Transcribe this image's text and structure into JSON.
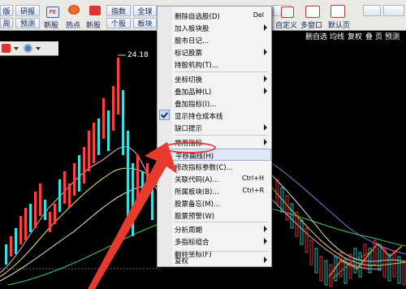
{
  "toolbar": {
    "row1": {
      "b1": "版",
      "b2": "研报",
      "b3": "指数",
      "b4": "全球"
    },
    "row2": {
      "b1": "周",
      "b2": "预测",
      "b3": "新股",
      "b4": "个股",
      "b5": "板块"
    },
    "icon_labels": {
      "pe": "PE",
      "xingu": "新股",
      "redian": "热点"
    },
    "right": {
      "zidingyi": "自定义",
      "duoduo": "多窗口",
      "moren": "默认页"
    }
  },
  "subbar": {
    "items": [
      "删自选",
      "均线",
      "复权",
      "叠",
      "页",
      "预测",
      "⬜"
    ]
  },
  "chart": {
    "price_label": "24.18"
  },
  "menu": {
    "items": [
      {
        "label": "删除自选股(D)",
        "shortcut": "Del"
      },
      {
        "label": "加入板块股",
        "submenu": true
      },
      {
        "label": "股市日记..."
      },
      {
        "label": "标记股票",
        "submenu": true
      },
      {
        "label": "持股机构(T)..."
      },
      {
        "label": "坐标切换",
        "submenu": true
      },
      {
        "label": "叠加品种(L)",
        "submenu": true
      },
      {
        "label": "叠加指标(I)..."
      },
      {
        "label": "显示持仓成本线",
        "checked": true
      },
      {
        "label": "缺口提示",
        "submenu": true
      },
      {
        "label": "常用指标",
        "submenu": true
      },
      {
        "label": "平移曲线(H)"
      },
      {
        "label": "修改指标参数(C)..."
      },
      {
        "label": "关联代码(A)...",
        "shortcut": "Ctrl+H"
      },
      {
        "label": "所属板块(B)...",
        "shortcut": "Ctrl+R"
      },
      {
        "label": "股票备忘(M)..."
      },
      {
        "label": "股票预警(W)"
      },
      {
        "label": "分析周期",
        "submenu": true
      },
      {
        "label": "多指标组合",
        "submenu": true
      },
      {
        "label": "翻转坐标(F)"
      },
      {
        "label": "复权",
        "submenu": true
      }
    ]
  },
  "colors": {
    "highlight_oval": "#e53a2c",
    "arrow": "#e53a2c",
    "bg": "#000000"
  }
}
